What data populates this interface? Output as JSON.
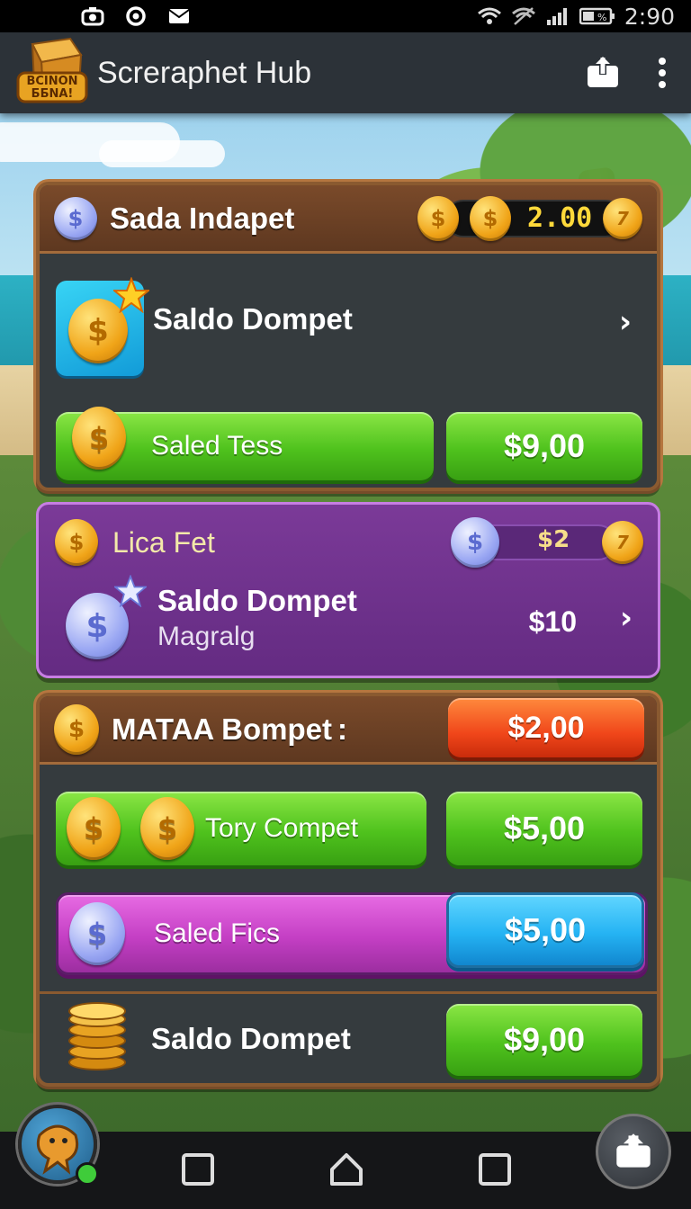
{
  "status_bar": {
    "time": "2:90",
    "icons": [
      "camera-icon",
      "target-icon",
      "mail-icon",
      "wifi-icon",
      "signal-icon",
      "battery-icon"
    ],
    "battery_label": "%"
  },
  "app_bar": {
    "logo_text": [
      "BCINON",
      "ББNA!"
    ],
    "title": "Screraphet Hub",
    "actions": [
      "share-icon",
      "more-vert-icon"
    ]
  },
  "card1": {
    "title": "Sada Indapet",
    "balance": "2.00",
    "balance_badge": "7",
    "wallet_label": "Saldo Dompet",
    "left_button_label": "Saled Tess",
    "right_button_label": "$9,00"
  },
  "card2": {
    "title": "Lica Fet",
    "balance": "$2",
    "badge": "7",
    "wallet_label": "Saldo Dompet",
    "wallet_sublabel": "Magralg",
    "amount": "$10"
  },
  "card3": {
    "title": "MATAA Bompet",
    "title_suffix": ":",
    "header_button": "$2,00",
    "row1_label": "Tory Compet",
    "row1_value": "$5,00",
    "row2_label": "Saled Fics",
    "row2_value": "$5,00",
    "row3_label": "Saldo Dompet",
    "row3_value": "$9,00"
  },
  "coin_symbol": "$",
  "colors": {
    "green": "#4fc21d",
    "red": "#f0461a",
    "purple": "#6b2d86",
    "magenta": "#c43fc4",
    "cyan": "#25b3f3",
    "gold": "#f0a418"
  }
}
